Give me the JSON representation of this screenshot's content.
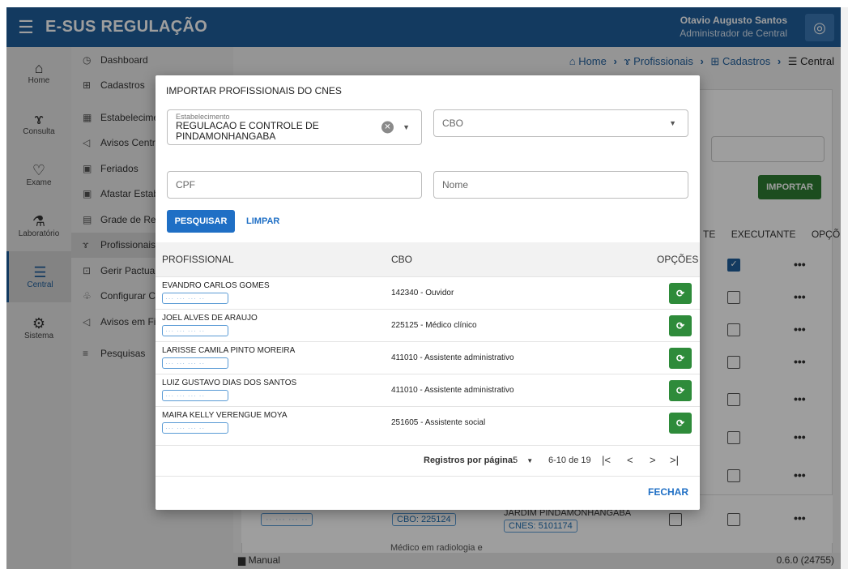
{
  "header": {
    "app_title": "E-SUS REGULAÇÃO",
    "user_name": "Otavio Augusto Santos",
    "user_role": "Administrador de Central"
  },
  "rail": [
    {
      "label": "Home",
      "icon": "home-icon"
    },
    {
      "label": "Consulta",
      "icon": "stethoscope-icon"
    },
    {
      "label": "Exame",
      "icon": "heart-monitor-icon"
    },
    {
      "label": "Laboratório",
      "icon": "flask-icon"
    },
    {
      "label": "Central",
      "icon": "server-icon"
    },
    {
      "label": "Sistema",
      "icon": "gear-icon"
    }
  ],
  "submenu": [
    {
      "label": "Dashboard",
      "icon": "dashboard-icon"
    },
    {
      "label": "Cadastros",
      "icon": "plus-box-icon"
    },
    {
      "label": "Estabelecimentos",
      "icon": "building-icon"
    },
    {
      "label": "Avisos Central",
      "icon": "megaphone-icon"
    },
    {
      "label": "Feriados",
      "icon": "calendar-icon"
    },
    {
      "label": "Afastar Estabelecimento",
      "icon": "calendar-x-icon"
    },
    {
      "label": "Grade de Referência",
      "icon": "grid-icon"
    },
    {
      "label": "Profissionais",
      "icon": "stethoscope-icon"
    },
    {
      "label": "Gerir Pactuação",
      "icon": "handshake-icon"
    },
    {
      "label": "Configurar Central",
      "icon": "sitemap-icon"
    },
    {
      "label": "Avisos em Ficha",
      "icon": "megaphone-icon"
    },
    {
      "label": "Pesquisas",
      "icon": "list-search-icon"
    }
  ],
  "breadcrumb": {
    "home": "Home",
    "profissionais": "Profissionais",
    "cadastros": "Cadastros",
    "central": "Central"
  },
  "background": {
    "importar_label": "IMPORTAR",
    "col_te": "TE",
    "col_executante": "EXECUTANTE",
    "col_opcoes": "OPÇÕES",
    "row_cbo_pill": "CBO: 225124",
    "row_establishment": "JARDIM PINDAMONHANGABA",
    "row_cnes_pill": "CNES: 5101174",
    "row_spec": "Médico em radiologia e"
  },
  "footer": {
    "manual": "Manual",
    "version": "0.6.0 (24755)"
  },
  "modal": {
    "title": "IMPORTAR PROFISSIONAIS DO CNES",
    "estabelecimento_label": "Estabelecimento",
    "estabelecimento_value": "REGULACAO E CONTROLE DE PINDAMONHANGABA",
    "cbo_placeholder": "CBO",
    "cpf_placeholder": "CPF",
    "nome_placeholder": "Nome",
    "pesquisar_label": "PESQUISAR",
    "limpar_label": "LIMPAR",
    "col_profissional": "PROFISSIONAL",
    "col_cbo": "CBO",
    "col_opcoes": "OPÇÕES",
    "rows": [
      {
        "name": "EVANDRO CARLOS GOMES",
        "cbo": "142340 - Ouvidor"
      },
      {
        "name": "JOEL ALVES DE ARAUJO",
        "cbo": "225125 - Médico clínico"
      },
      {
        "name": "LARISSE CAMILA PINTO MOREIRA",
        "cbo": "411010 - Assistente administrativo"
      },
      {
        "name": "LUIZ GUSTAVO DIAS DOS SANTOS",
        "cbo": "411010 - Assistente administrativo"
      },
      {
        "name": "MAIRA KELLY VERENGUE MOYA",
        "cbo": "251605 - Assistente social"
      }
    ],
    "rows_per_page_label": "Registros por página:",
    "rows_per_page_value": "5",
    "range_label": "6-10 de 19",
    "fechar_label": "FECHAR"
  }
}
